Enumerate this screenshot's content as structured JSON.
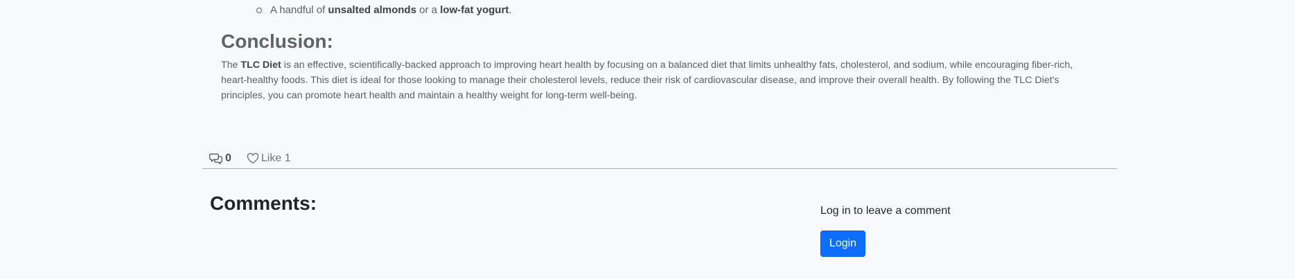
{
  "article": {
    "snack_item": {
      "prefix": "A handful of",
      "bold1": "unsalted almonds",
      "middle": "or a",
      "bold2": "low-fat yogurt",
      "suffix": "."
    },
    "conclusion": {
      "heading": "Conclusion:",
      "prefix": "The",
      "bold": "TLC Diet",
      "text": "is an effective, scientifically-backed approach to improving heart health by focusing on a balanced diet that limits unhealthy fats, cholesterol, and sodium, while encouraging fiber-rich, heart-healthy foods. This diet is ideal for those looking to manage their cholesterol levels, reduce their risk of cardiovascular disease, and improve their overall health. By following the TLC Diet's principles, you can promote heart health and maintain a healthy weight for long-term well-being."
    }
  },
  "meta": {
    "comment_count": "0",
    "like_label": "Like 1",
    "comment_icon": "chat-bubbles-icon",
    "like_icon": "heart-outline-icon"
  },
  "comments": {
    "heading": "Comments:",
    "login_prompt": "Log in to leave a comment",
    "login_button": "Login"
  },
  "colors": {
    "background": "#f8f9fa",
    "primary_button": "#0d6efd",
    "body_text": "#5a5f64"
  }
}
